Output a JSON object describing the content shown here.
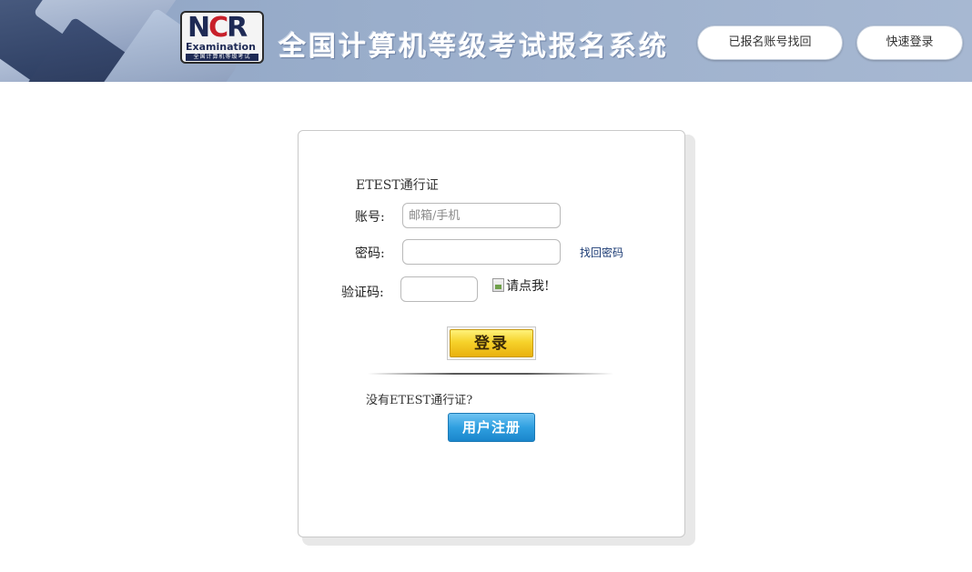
{
  "header": {
    "logo_text": "NCR",
    "logo_sub": "Examination",
    "logo_strip": "全国计算机等级考试",
    "title": "全国计算机等级考试报名系统",
    "recover_button": "已报名账号找回",
    "quick_login_button": "快速登录"
  },
  "login": {
    "pass_name": "ETEST通行证",
    "account_label": "账号:",
    "account_placeholder": "邮箱/手机",
    "account_value": "",
    "password_label": "密码:",
    "password_value": "",
    "forgot_link": "找回密码",
    "captcha_label": "验证码:",
    "captcha_value": "",
    "captcha_image_alt": "请点我!",
    "login_button": "登录",
    "no_pass_text": "没有ETEST通行证?",
    "register_button": "用户注册"
  },
  "colors": {
    "header_bg": "#9aaecb",
    "login_button": "#f6d22b",
    "register_button": "#2f9fe0",
    "link": "#1a3a73"
  }
}
